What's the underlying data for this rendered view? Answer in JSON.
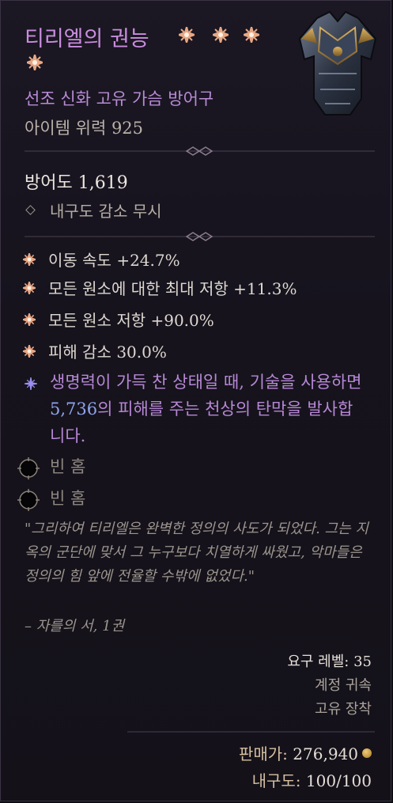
{
  "item": {
    "name": "티리엘의 권능",
    "subtitle": "선조 신화 고유 가슴 방어구",
    "item_power": "아이템 위력 925",
    "armor": "방어도 1,619",
    "durability_note": "내구도 감소 무시",
    "affixes": [
      "이동 속도 +24.7%",
      "모든 원소에 대한 최대 저항 +11.3%",
      "모든 원소 저항 +90.0%",
      "피해 감소 30.0%"
    ],
    "unique_power": {
      "before": "생명력이 가득 찬 상태일 때, 기술을 사용하면 ",
      "number": "5,736",
      "after": "의 피해를 주는 천상의 탄막을 발사합니다."
    },
    "sockets": [
      "빈 홈",
      "빈 홈"
    ],
    "flavor": "\"그리하여 티리엘은 완벽한 정의의 사도가 되었다. 그는 지옥의 군단에 맞서 그 누구보다 치열하게 싸웠고, 악마들은 정의의 힘 앞에 전율할 수밖에 없었다.\"",
    "flavor_source": "– 자를의 서, 1권",
    "requirements": {
      "level": "요구 레벨: 35",
      "account_bound": "계정 귀속",
      "unique_equip": "고유 장착"
    },
    "sell_label": "판매가:",
    "sell_value": "276,940",
    "durability_label": "내구도:",
    "durability_value": "100/100"
  },
  "colors": {
    "title": "#c98ddd",
    "subtitle": "#b98bd6",
    "unique_power": "#b788d6",
    "number_highlight": "#8ea4ee",
    "affix_icon": "#e8a784",
    "background": "#17141e"
  },
  "icons": {
    "greater_affix": "greater-affix-star-icon",
    "unique_power": "unique-power-star-icon",
    "socket": "empty-socket-icon",
    "gold": "gold-coin-icon",
    "durability": "diamond-bullet-icon"
  }
}
